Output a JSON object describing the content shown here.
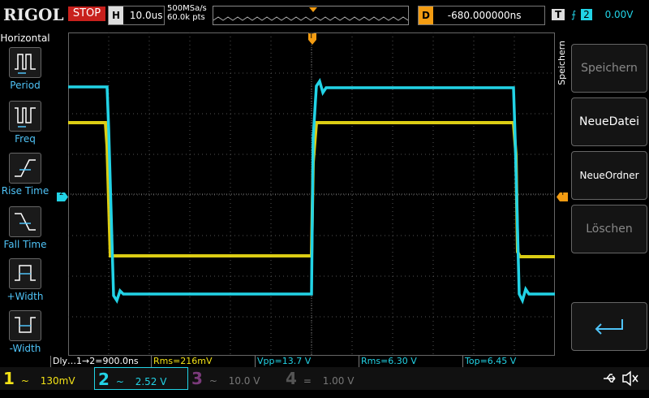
{
  "header": {
    "logo": "RIGOL",
    "run_state": "STOP",
    "horizontal_label": "H",
    "timebase": "10.0us",
    "sample_rate": "500MSa/s",
    "points": "60.0k pts",
    "delay_label": "D",
    "delay": "-680.000000ns",
    "trigger_label": "T",
    "trigger_source": "2",
    "trigger_level": "0.00V"
  },
  "left_menu": {
    "title": "Horizontal",
    "items": [
      {
        "label": "Period",
        "icon": "period-icon"
      },
      {
        "label": "Freq",
        "icon": "freq-icon"
      },
      {
        "label": "Rise Time",
        "icon": "rise-time-icon"
      },
      {
        "label": "Fall Time",
        "icon": "fall-time-icon"
      },
      {
        "label": "+Width",
        "icon": "plus-width-icon"
      },
      {
        "label": "-Width",
        "icon": "minus-width-icon"
      }
    ]
  },
  "markers": {
    "trigger_top": "T",
    "ch2_ground": "2",
    "trigger_level": "T"
  },
  "right_menu": {
    "title": "Speichern",
    "buttons": [
      {
        "label": "Speichern",
        "enabled": false
      },
      {
        "label": "NeueDatei",
        "enabled": true
      },
      {
        "label": "NeueOrdner",
        "enabled": true
      },
      {
        "label": "Löschen",
        "enabled": false
      }
    ]
  },
  "measurements": [
    "Dly…1→2=900.0ns",
    "Rms=216mV",
    "Vpp=13.7 V",
    "Rms=6.30 V",
    "Top=6.45 V"
  ],
  "channels": [
    {
      "num": "1",
      "coupling": "~",
      "scale": "130mV",
      "color": "#f4e316",
      "active": true
    },
    {
      "num": "2",
      "coupling": "~",
      "scale": "2.52 V",
      "color": "#22d3e6",
      "active": true
    },
    {
      "num": "3",
      "coupling": "~",
      "scale": "10.0 V",
      "color": "#c03cbf",
      "active": false
    },
    {
      "num": "4",
      "coupling": "=",
      "scale": "1.00 V",
      "color": "#3a6fd8",
      "active": false
    }
  ],
  "colors": {
    "ch1": "#f4e316",
    "ch2": "#22d3e6",
    "trigger": "#f39c12",
    "stop": "#c8201c"
  }
}
